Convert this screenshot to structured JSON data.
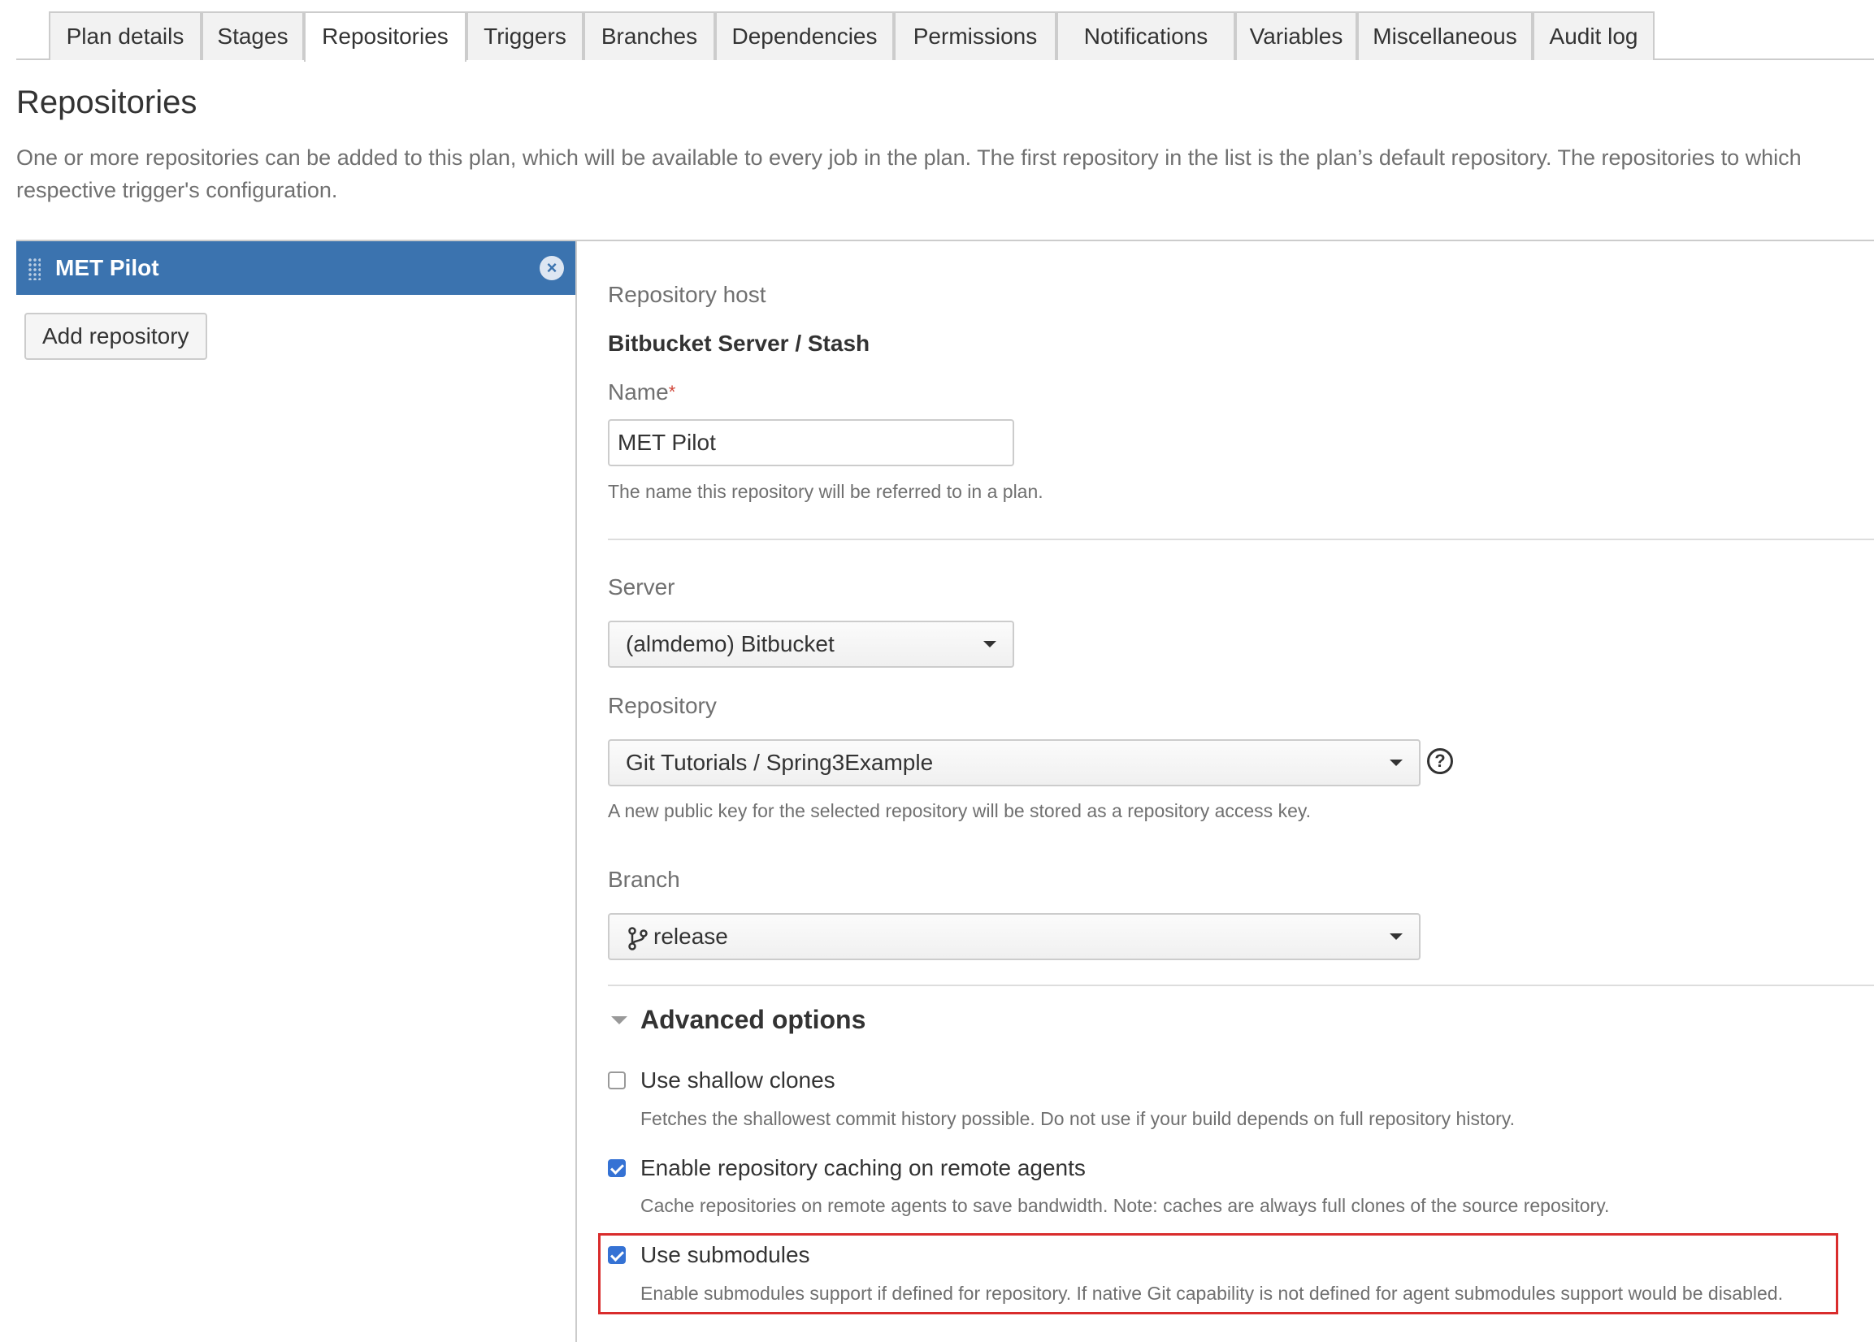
{
  "tabs": [
    {
      "label": "Plan details"
    },
    {
      "label": "Stages"
    },
    {
      "label": "Repositories"
    },
    {
      "label": "Triggers"
    },
    {
      "label": "Branches"
    },
    {
      "label": "Dependencies"
    },
    {
      "label": "Permissions"
    },
    {
      "label": "Notifications"
    },
    {
      "label": "Variables"
    },
    {
      "label": "Miscellaneous"
    },
    {
      "label": "Audit log"
    }
  ],
  "page": {
    "title": "Repositories",
    "intro_line1": "One or more repositories can be added to this plan, which will be available to every job in the plan. The first repository in the list is the plan’s default repository. The repositories to which",
    "intro_line2": "respective trigger's configuration."
  },
  "sidebar": {
    "repos": [
      {
        "name": "MET Pilot"
      }
    ],
    "add_repository_label": "Add repository",
    "remove_symbol": "×"
  },
  "form": {
    "host_label": "Repository host",
    "host_value": "Bitbucket Server / Stash",
    "name_label": "Name",
    "required_marker": "*",
    "name_value": "MET Pilot",
    "name_help": "The name this repository will be referred to in a plan.",
    "server_label": "Server",
    "server_value": "(almdemo) Bitbucket",
    "repository_label": "Repository",
    "repository_value": "Git Tutorials / Spring3Example",
    "help_symbol": "?",
    "repository_help": "A new public key for the selected repository will be stored as a repository access key.",
    "branch_label": "Branch",
    "branch_value": "release"
  },
  "advanced": {
    "title": "Advanced options",
    "options": [
      {
        "label": "Use shallow clones",
        "checked": false,
        "help": "Fetches the shallowest commit history possible. Do not use if your build depends on full repository history."
      },
      {
        "label": "Enable repository caching on remote agents",
        "checked": true,
        "help": "Cache repositories on remote agents to save bandwidth. Note: caches are always full clones of the source repository."
      },
      {
        "label": "Use submodules",
        "checked": true,
        "help": "Enable submodules support if defined for repository. If native Git capability is not defined for agent submodules support would be disabled."
      }
    ]
  },
  "colors": {
    "accent": "#3b73af",
    "checkbox": "#3572d4",
    "highlight": "#d92c2c",
    "required": "#d04437"
  }
}
